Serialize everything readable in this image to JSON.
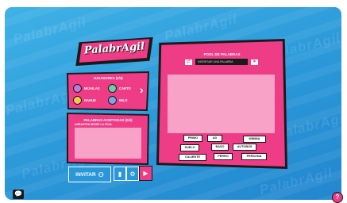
{
  "logo": {
    "text": "PalabrAgil"
  },
  "players": {
    "title": "JUGADORES (4/4)",
    "list": [
      {
        "name": "MIJAILAS",
        "color": "#c07ad9"
      },
      {
        "name": "CARTO",
        "color": "#6ad0b0"
      },
      {
        "name": "NAHUE",
        "color": "#f2c94c"
      },
      {
        "name": "MILO",
        "color": "#7aa8e8"
      }
    ]
  },
  "accepted": {
    "title": "PALABRAS ACEPTADAS (0/4)",
    "subtitle": "ARRASTRA DESDE LA POOL"
  },
  "actions": {
    "invite_label": "INVITAR"
  },
  "pool": {
    "title": "POOL DE PALABRAS",
    "input_placeholder": "INGRESAR UNA PALABRA",
    "words": [
      "PRIMO",
      "AD",
      "MINIMA",
      "SUELO",
      "BASO",
      "AUTOBÚS",
      "CALIENTE",
      "PERRO",
      "PERSONA"
    ]
  },
  "colors": {
    "accent_pink": "#ee3c86",
    "light_pink": "#f9a2c8",
    "background_blue": "#2a97d8",
    "outline": "#1a1a1a"
  }
}
